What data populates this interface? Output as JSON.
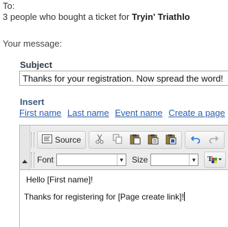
{
  "header": {
    "to_label": "To:",
    "recipients_text": "3 people who bought a ticket  for ",
    "event_name": "Tryin' Triathlo"
  },
  "message": {
    "label": "Your message:"
  },
  "subject": {
    "label": "Subject",
    "value": "Thanks for your registration. Now spread the word!"
  },
  "insert": {
    "label": "Insert",
    "links": [
      "First name",
      "Last name",
      "Event name",
      "Create a page"
    ]
  },
  "editor": {
    "toolbar": {
      "source_label": "Source",
      "font_label": "Font",
      "size_label": "Size",
      "icons": [
        "source-icon",
        "cut-icon",
        "copy-icon",
        "paste-icon",
        "paste-text-icon",
        "paste-word-icon",
        "undo-icon",
        "redo-icon",
        "text-color-icon"
      ]
    },
    "content": {
      "line1": "Hello [First name]!",
      "line2": "Thanks for registering for [Page create link]!"
    }
  },
  "colors": {
    "link": "#2a5db0",
    "subject_label": "#2d3a48",
    "insert_label": "#3c5a7a",
    "undo_blue": "#2b6fd6"
  }
}
